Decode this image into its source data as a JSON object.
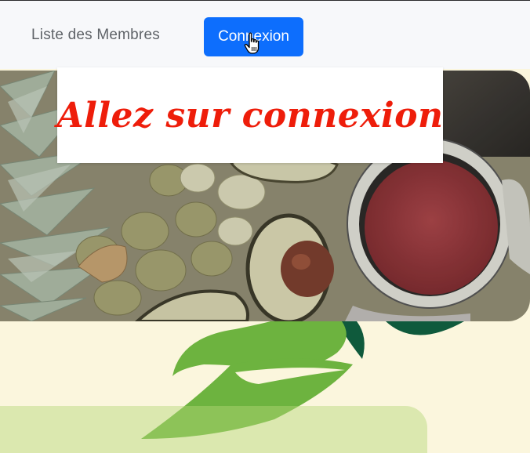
{
  "nav": {
    "members_link": "Liste des Membres",
    "login_button": "Connexion"
  },
  "banner": {
    "text": "Allez sur connexion"
  },
  "colors": {
    "primary": "#0d6efd",
    "banner_text": "#ee1d0a",
    "page_bg": "#fbf6dd",
    "leaf_light": "#6db33f",
    "leaf_dark": "#0f5a3c"
  },
  "icons": [
    "hand-pointer-cursor-icon",
    "leaf-decoration"
  ]
}
